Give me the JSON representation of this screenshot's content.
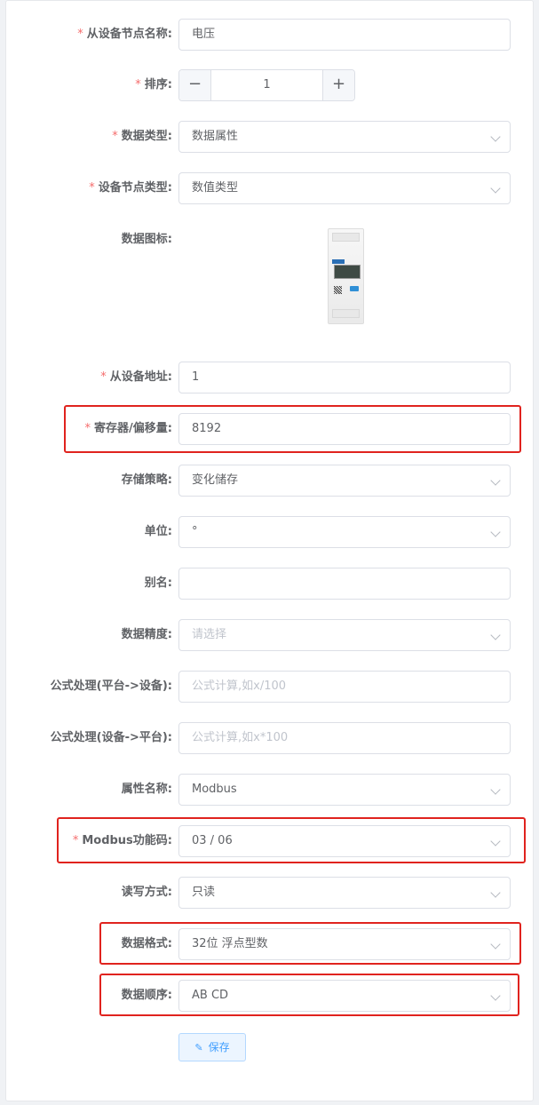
{
  "form": {
    "fields": [
      {
        "key": "slave_node_name",
        "label": "从设备节点名称:",
        "required": true,
        "type": "input",
        "value": "电压"
      },
      {
        "key": "sort",
        "label": "排序:",
        "required": true,
        "type": "stepper",
        "value": "1",
        "minus": "−",
        "plus": "+"
      },
      {
        "key": "data_type",
        "label": "数据类型:",
        "required": true,
        "type": "select",
        "value": "数据属性"
      },
      {
        "key": "node_type",
        "label": "设备节点类型:",
        "required": true,
        "type": "select",
        "value": "数值类型"
      },
      {
        "key": "data_icon",
        "label": "数据图标:",
        "required": false,
        "type": "image",
        "image_text": "CHINT"
      },
      {
        "key": "slave_address",
        "label": "从设备地址:",
        "required": true,
        "type": "input",
        "value": "1"
      },
      {
        "key": "register_offset",
        "label": "寄存器/偏移量:",
        "required": true,
        "type": "input",
        "value": "8192"
      },
      {
        "key": "storage_policy",
        "label": "存储策略:",
        "required": false,
        "type": "select",
        "value": "变化储存"
      },
      {
        "key": "unit",
        "label": "单位:",
        "required": false,
        "type": "select",
        "value": "°"
      },
      {
        "key": "alias",
        "label": "别名:",
        "required": false,
        "type": "input",
        "value": ""
      },
      {
        "key": "precision",
        "label": "数据精度:",
        "required": false,
        "type": "select",
        "value": "",
        "placeholder": "请选择"
      },
      {
        "key": "formula_to_device",
        "label": "公式处理(平台->设备):",
        "required": false,
        "type": "input",
        "value": "",
        "placeholder": "公式计算,如x/100"
      },
      {
        "key": "formula_to_platform",
        "label": "公式处理(设备->平台):",
        "required": false,
        "type": "input",
        "value": "",
        "placeholder": "公式计算,如x*100"
      },
      {
        "key": "attribute_name",
        "label": "属性名称:",
        "required": false,
        "type": "select",
        "value": "Modbus"
      },
      {
        "key": "modbus_function_code",
        "label": "Modbus功能码:",
        "required": true,
        "type": "select",
        "value": "03 / 06"
      },
      {
        "key": "read_write_mode",
        "label": "读写方式:",
        "required": false,
        "type": "select",
        "value": "只读"
      },
      {
        "key": "data_format",
        "label": "数据格式:",
        "required": false,
        "type": "select",
        "value": "32位 浮点型数"
      },
      {
        "key": "data_order",
        "label": "数据顺序:",
        "required": false,
        "type": "select",
        "value": "AB CD"
      }
    ],
    "required_mark": "*",
    "save_label": "保存",
    "save_icon": "edit-icon"
  },
  "colors": {
    "required": "#f56c6c",
    "highlight": "#e0231e",
    "primary": "#409eff"
  }
}
